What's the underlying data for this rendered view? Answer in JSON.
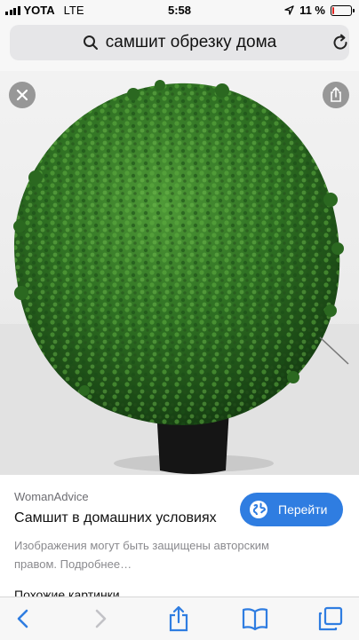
{
  "status_bar": {
    "carrier": "YOTA",
    "network": "LTE",
    "time": "5:58",
    "battery_text": "11 %",
    "battery_level": 0.11
  },
  "search": {
    "query": "самшит обрезку дома"
  },
  "image": {
    "subject": "boxwood ball topiary in black pot"
  },
  "info": {
    "source": "WomanAdvice",
    "title": "Самшит в домашних условиях",
    "visit_label": "Перейти",
    "notice": "Изображения могут быть защищены авторским правом. Подробнее…",
    "similar_label": "Похожие картинки"
  },
  "colors": {
    "accent": "#2f7de1",
    "battery_low": "#e0231e",
    "toolbar_icon": "#2f7de1",
    "toolbar_disabled": "#c2c2c6"
  },
  "icons": {
    "close": "close-icon",
    "share": "share-icon",
    "search": "search-icon",
    "reload": "reload-icon",
    "globe": "globe-icon",
    "back": "back-icon",
    "forward": "forward-icon",
    "bookmarks": "bookmarks-icon",
    "tabs": "tabs-icon"
  }
}
